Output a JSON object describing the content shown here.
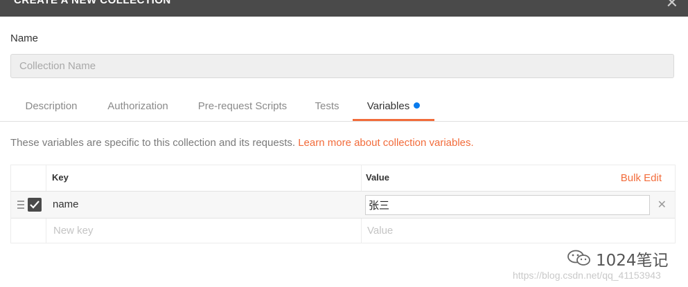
{
  "dialog": {
    "title": "CREATE A NEW COLLECTION",
    "close_glyph": "✕"
  },
  "name_field": {
    "label": "Name",
    "placeholder": "Collection Name",
    "value": ""
  },
  "tabs": [
    {
      "label": "Description",
      "active": false
    },
    {
      "label": "Authorization",
      "active": false
    },
    {
      "label": "Pre-request Scripts",
      "active": false
    },
    {
      "label": "Tests",
      "active": false
    },
    {
      "label": "Variables",
      "active": true,
      "indicator_color": "#097bed"
    }
  ],
  "info": {
    "text": "These variables are specific to this collection and its requests.",
    "link": "Learn more about collection variables."
  },
  "table": {
    "headers": {
      "key": "Key",
      "value": "Value",
      "bulk_edit": "Bulk Edit"
    },
    "rows": [
      {
        "checked": true,
        "key": "name",
        "value": "张三"
      }
    ],
    "new_row": {
      "key_placeholder": "New key",
      "value_placeholder": "Value"
    }
  },
  "watermark": {
    "name": "1024笔记",
    "url": "https://blog.csdn.net/qq_41153943"
  },
  "colors": {
    "accent": "#f26b3a",
    "titlebar": "#4a4a4a",
    "unsaved_dot": "#097bed"
  }
}
